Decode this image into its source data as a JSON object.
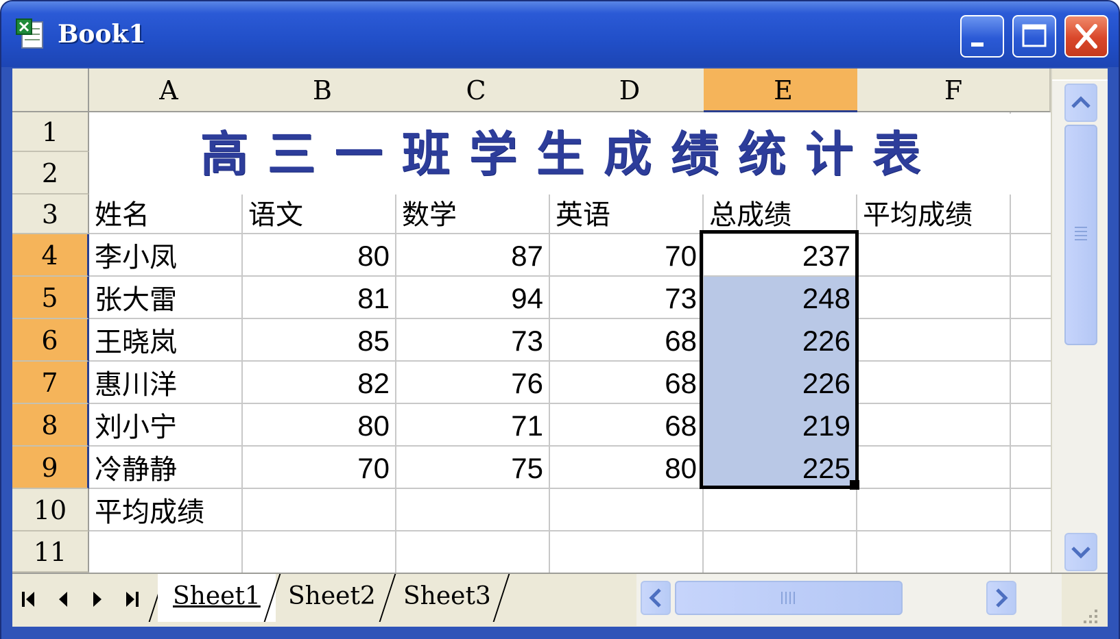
{
  "window": {
    "title": "Book1"
  },
  "columns": [
    "A",
    "B",
    "C",
    "D",
    "E",
    "F"
  ],
  "rows": [
    "1",
    "2",
    "3",
    "4",
    "5",
    "6",
    "7",
    "8",
    "9",
    "10",
    "11"
  ],
  "sheet_title": "高三一班学生成绩统计表",
  "headers": [
    "姓名",
    "语文",
    "数学",
    "英语",
    "总成绩",
    "平均成绩"
  ],
  "students": [
    {
      "name": "李小凤",
      "chinese": "80",
      "math": "87",
      "english": "70",
      "total": "237"
    },
    {
      "name": "张大雷",
      "chinese": "81",
      "math": "94",
      "english": "73",
      "total": "248"
    },
    {
      "name": "王晓岚",
      "chinese": "85",
      "math": "73",
      "english": "68",
      "total": "226"
    },
    {
      "name": "惠川洋",
      "chinese": "82",
      "math": "76",
      "english": "68",
      "total": "226"
    },
    {
      "name": "刘小宁",
      "chinese": "80",
      "math": "71",
      "english": "68",
      "total": "219"
    },
    {
      "name": "冷静静",
      "chinese": "70",
      "math": "75",
      "english": "80",
      "total": "225"
    }
  ],
  "footer_row_label": "平均成绩",
  "selection": {
    "column": "E",
    "rows": [
      "4",
      "5",
      "6",
      "7",
      "8",
      "9"
    ]
  },
  "sheet_tabs": [
    "Sheet1",
    "Sheet2",
    "Sheet3"
  ],
  "active_sheet": "Sheet1",
  "colors": {
    "title_bar": "#2b5ad6",
    "selected_header": "#f5b45a",
    "selection_fill": "#b9c8e6",
    "title_text": "#2d3d9a"
  },
  "icons": [
    "excel-app-icon",
    "minimize-icon",
    "maximize-icon",
    "close-icon",
    "scroll-up-icon",
    "scroll-down-icon",
    "scroll-left-icon",
    "scroll-right-icon",
    "first-sheet-icon",
    "prev-sheet-icon",
    "next-sheet-icon",
    "last-sheet-icon"
  ]
}
